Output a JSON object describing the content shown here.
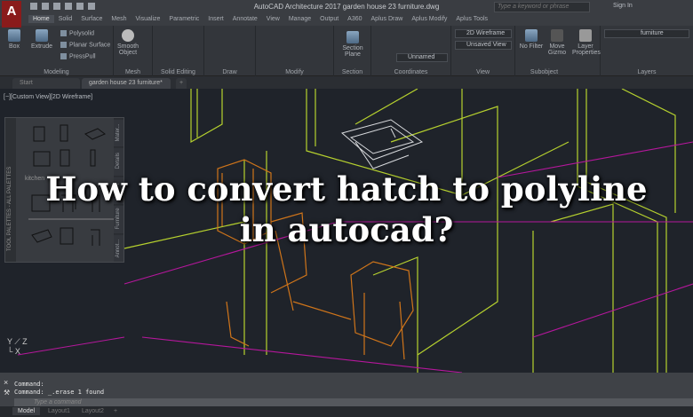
{
  "app": {
    "logo": "A",
    "title": "AutoCAD Architecture 2017   garden house 23 furniture.dwg",
    "search_placeholder": "Type a keyword or phrase",
    "sign_in": "Sign In"
  },
  "menu_tabs": [
    "Home",
    "Solid",
    "Surface",
    "Mesh",
    "Visualize",
    "Parametric",
    "Insert",
    "Annotate",
    "View",
    "Manage",
    "Output",
    "A360",
    "Aplus Draw",
    "Aplus Modify",
    "Aplus Tools"
  ],
  "ribbon": {
    "modeling": {
      "label": "Modeling",
      "box": "Box",
      "extrude": "Extrude",
      "polysolid": "Polysolid",
      "planar_surface": "Planar Surface",
      "presspull": "PressPull"
    },
    "mesh": {
      "label": "Mesh",
      "smooth_object": "Smooth Object"
    },
    "solid_editing": {
      "label": "Solid Editing"
    },
    "draw": {
      "label": "Draw"
    },
    "modify": {
      "label": "Modify"
    },
    "section": {
      "label": "Section",
      "section_plane": "Section Plane"
    },
    "coordinates": {
      "label": "Coordinates",
      "ucs_value": "Unnamed"
    },
    "view": {
      "label": "View",
      "visual_style": "2D Wireframe",
      "saved_view": "Unsaved View"
    },
    "subobject": {
      "label": "Subobject",
      "no_filter": "No Filter",
      "move_gizmo": "Move Gizmo"
    },
    "layers": {
      "label": "Layers",
      "layer_properties": "Layer Properties",
      "current_layer": "furniture"
    }
  },
  "doc_tabs": {
    "start": "Start",
    "active": "garden house 23 furniture*"
  },
  "viewport": {
    "label": "[−][Custom View][2D Wireframe]",
    "palette_title": "TOOL PALETTES - ALL PALETTES",
    "palette_group": "kitchen",
    "palette_tabs": [
      "Mater...",
      "Details",
      "Doors",
      "Furniture",
      "Annot..."
    ]
  },
  "headline": {
    "line1": "How to convert hatch to polyline",
    "line2": "in autocad?"
  },
  "command": {
    "lines": [
      "Command:",
      "Command:  _.erase 1 found"
    ],
    "placeholder": "Type a command"
  },
  "layout_tabs": [
    "Model",
    "Layout1",
    "Layout2",
    "+"
  ],
  "colors": {
    "background": "#1f232a",
    "ribbon": "#33363b",
    "wire_green": "#b6d12e",
    "wire_orange": "#d0751a",
    "wire_magenta": "#b5179c"
  }
}
